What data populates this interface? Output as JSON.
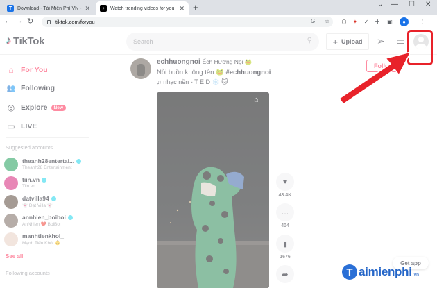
{
  "browser": {
    "tabs": [
      {
        "title": "Download - Tải Miễn Phí VN - Phầ",
        "favicon_letter": "T",
        "favicon_color": "#1a73e8"
      },
      {
        "title": "Watch trending videos for you",
        "favicon_letter": "♪",
        "favicon_color": "#000000"
      }
    ],
    "new_tab": "+",
    "url": "tiktok.com/foryou"
  },
  "header": {
    "logo": "TikTok",
    "search_placeholder": "Search",
    "upload_label": "Upload",
    "upload_plus": "+"
  },
  "sidebar": {
    "nav": [
      {
        "label": "For You",
        "icon": "home-icon",
        "glyph": "⌂",
        "active": true
      },
      {
        "label": "Following",
        "icon": "people-icon",
        "glyph": "👥",
        "active": false
      },
      {
        "label": "Explore",
        "icon": "compass-icon",
        "glyph": "◎",
        "active": false,
        "badge": "New"
      },
      {
        "label": "LIVE",
        "icon": "live-icon",
        "glyph": "▭",
        "active": false
      }
    ],
    "suggested_title": "Suggested accounts",
    "accounts": [
      {
        "name": "theanh28entertai...",
        "sub": "Theanh28 Entertainment",
        "color": "#1f9e5a",
        "verified": true
      },
      {
        "name": "tiin.vn",
        "sub": "Tiin.vn",
        "color": "#d6257a",
        "verified": true
      },
      {
        "name": "datvilla94",
        "sub": "👻 Đạt Villa 👻",
        "color": "#5b4a3d",
        "verified": true
      },
      {
        "name": "annhien_boiboi",
        "sub": "AnNhien ❤️ BoiBoi",
        "color": "#7a6a62",
        "verified": true
      },
      {
        "name": "manhtienkhoi_",
        "sub": "Mạnh Tiến Khôi 👶",
        "color": "#e8cfc4",
        "verified": false
      }
    ],
    "see_all": "See all",
    "following_title": "Following accounts"
  },
  "post": {
    "username": "echhuongnoi",
    "nickname": "Ếch Hướng Nội 🐸",
    "caption": "Nỗi buồn không tên 🐸",
    "hashtag": "#echhuongnoi",
    "music": "♫ nhạc nền - T E D ❄️ 🐱",
    "follow_label": "Follow",
    "likes": "43.4K",
    "comments": "404",
    "saves": "1676"
  },
  "get_app": "Get app",
  "watermark": {
    "letter": "T",
    "text": "aimienphi",
    "suffix": ".vn"
  },
  "colors": {
    "accent": "#fe2c55",
    "annotation_red": "#e8222a"
  }
}
